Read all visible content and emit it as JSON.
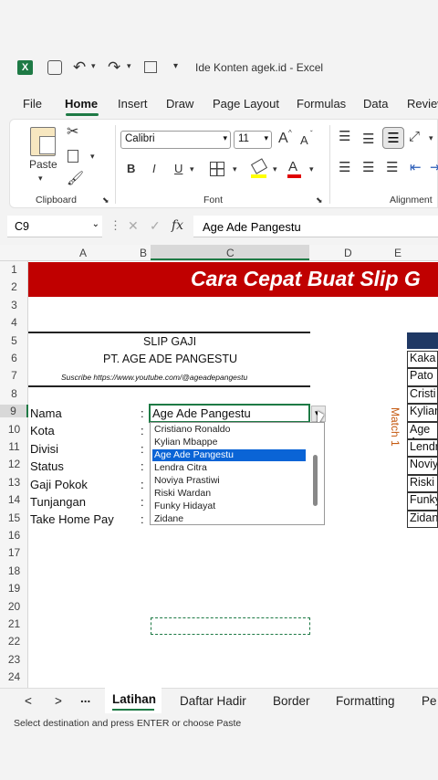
{
  "titlebar": {
    "title": "Ide Konten agek.id  -  Excel",
    "excel_icon": "excel-logo-icon",
    "autosave_icon": "autosave-icon",
    "undo_icon": "undo-icon",
    "redo_icon": "redo-icon",
    "form_icon": "form-icon"
  },
  "menu": {
    "items": [
      "File",
      "Home",
      "Insert",
      "Draw",
      "Page Layout",
      "Formulas",
      "Data",
      "Review"
    ]
  },
  "ribbon": {
    "clipboard": {
      "paste_label": "Paste",
      "group_label": "Clipboard"
    },
    "font": {
      "font_name": "Calibri",
      "font_size": "11",
      "group_label": "Font",
      "bold": "B",
      "italic": "I",
      "underline": "U",
      "font_color_glyph": "A",
      "grow_glyph": "A",
      "shrink_glyph": "A"
    },
    "alignment": {
      "group_label": "Alignment"
    }
  },
  "formula_bar": {
    "name_box": "C9",
    "fx": "fx",
    "value": "Age Ade Pangestu"
  },
  "columns": [
    "A",
    "B",
    "C",
    "D",
    "E"
  ],
  "rows": [
    "1",
    "2",
    "3",
    "4",
    "5",
    "6",
    "7",
    "8",
    "9",
    "10",
    "11",
    "12",
    "13",
    "14",
    "15",
    "16",
    "17",
    "18",
    "19",
    "20",
    "21",
    "22",
    "23",
    "24"
  ],
  "sheet": {
    "banner_title": "Cara Cepat Buat Slip G",
    "slip_title": "SLIP GAJI",
    "company": "PT. AGE ADE PANGESTU",
    "subscribe": "Suscribe https://www.youtube.com/@ageadepangestu",
    "fields": [
      "Nama",
      "Kota",
      "Divisi",
      "Status",
      "Gaji Pokok",
      "Tunjangan",
      "Take Home Pay"
    ],
    "colon": ":",
    "selected_name": "Age Ade Pangestu",
    "match_label": "Match 1"
  },
  "dropdown": {
    "options": [
      "Cristiano Ronaldo",
      "Kylian Mbappe",
      "Age Ade Pangestu",
      "Lendra Citra",
      "Noviya Prastiwi",
      "Riski Wardan",
      "Funky Hidayat",
      "Zidane"
    ],
    "selected_index": 2
  },
  "right_table": [
    "Kaka",
    "Pato",
    "Cristi",
    "Kylian",
    "Age A",
    "Lendr",
    "Noviy",
    "Riski",
    "Funky",
    "Zidan"
  ],
  "tabs": {
    "nav_prev": "<",
    "nav_next": ">",
    "more": "...",
    "items": [
      "Latihan",
      "Daftar Hadir",
      "Border",
      "Formatting",
      "Pe"
    ]
  },
  "status": "Select destination and press ENTER or choose Paste",
  "colors": {
    "excel_green": "#1e7a45",
    "banner_red": "#c00000",
    "dropdown_selected": "#0a64d6",
    "match_orange": "#c55a11",
    "table_header": "#1f3864"
  }
}
